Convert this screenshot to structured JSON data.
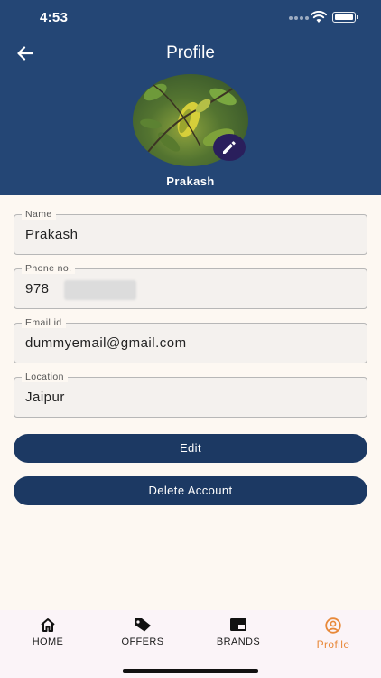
{
  "status_bar": {
    "time": "4:53"
  },
  "header": {
    "title": "Profile",
    "user_name": "Prakash"
  },
  "fields": [
    {
      "label": "Name",
      "value": "Prakash"
    },
    {
      "label": "Phone no.",
      "value": "978"
    },
    {
      "label": "Email id",
      "value": "dummyemail@gmail.com"
    },
    {
      "label": "Location",
      "value": "Jaipur"
    }
  ],
  "buttons": {
    "edit": "Edit",
    "delete": "Delete Account"
  },
  "tabs": [
    {
      "label": "HOME",
      "icon": "home-icon"
    },
    {
      "label": "OFFERS",
      "icon": "tag-icon"
    },
    {
      "label": "BRANDS",
      "icon": "brands-icon"
    },
    {
      "label": "Profile",
      "icon": "profile-icon",
      "active": true
    }
  ],
  "colors": {
    "header": "#244675",
    "button": "#1c3963",
    "active_tab": "#e8893a",
    "background": "#fdf8f2"
  }
}
